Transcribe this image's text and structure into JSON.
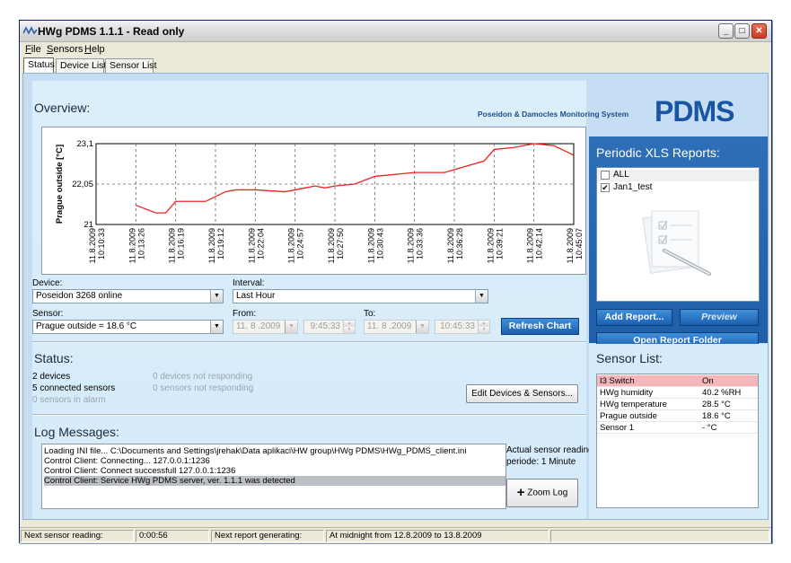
{
  "window": {
    "title": "HWg PDMS 1.1.1 - Read only"
  },
  "menu": {
    "items": [
      "File",
      "Sensors",
      "Help"
    ]
  },
  "tabs": [
    "Status",
    "Device List",
    "Sensor List"
  ],
  "brand": {
    "tagline": "Poseidon & Damocles Monitoring System",
    "logo": "PDMS"
  },
  "overview": {
    "title": "Overview:",
    "chart_data": {
      "type": "line",
      "ylabel": "Prague outside [°C]",
      "ylim": [
        21,
        23.1
      ],
      "yticks": [
        "23,1",
        "22,05",
        "21"
      ],
      "x": [
        "11.8.2009 10:10:33",
        "11.8.2009 10:13:26",
        "11.8.2009 10:16:19",
        "11.8.2009 10:19:12",
        "11.8.2009 10:22:04",
        "11.8.2009 10:24:57",
        "11.8.2009 10:27:50",
        "11.8.2009 10:30:43",
        "11.8.2009 10:33:36",
        "11.8.2009 10:36:28",
        "11.8.2009 10:39:21",
        "11.8.2009 10:42:14",
        "11.8.2009 10:45:07"
      ],
      "series": [
        {
          "color": "#ee2222",
          "points": [
            [
              1.0,
              21.5
            ],
            [
              1.5,
              21.3
            ],
            [
              1.75,
              21.3
            ],
            [
              2.0,
              21.6
            ],
            [
              2.75,
              21.6
            ],
            [
              3.25,
              21.85
            ],
            [
              3.5,
              21.9
            ],
            [
              4.0,
              21.9
            ],
            [
              4.75,
              21.85
            ],
            [
              5.0,
              21.9
            ],
            [
              5.5,
              22.0
            ],
            [
              5.75,
              21.95
            ],
            [
              6.0,
              22.0
            ],
            [
              6.5,
              22.05
            ],
            [
              7.0,
              22.25
            ],
            [
              8.0,
              22.35
            ],
            [
              8.75,
              22.35
            ],
            [
              9.25,
              22.5
            ],
            [
              9.75,
              22.65
            ],
            [
              10.0,
              22.95
            ],
            [
              10.5,
              23.0
            ],
            [
              11.0,
              23.1
            ],
            [
              11.5,
              23.05
            ],
            [
              11.8,
              22.9
            ],
            [
              12.0,
              22.8
            ]
          ]
        }
      ]
    },
    "device": {
      "label": "Device:",
      "value": "Poseidon 3268 online"
    },
    "interval": {
      "label": "Interval:",
      "value": "Last Hour"
    },
    "sensor": {
      "label": "Sensor:",
      "value": "Prague outside = 18.6 °C"
    },
    "from": {
      "label": "From:",
      "date": "11. 8 .2009",
      "time": "9:45:33"
    },
    "to": {
      "label": "To:",
      "date": "11. 8 .2009",
      "time": "10:45:33"
    },
    "refresh_button": "Refresh Chart"
  },
  "status": {
    "title": "Status:",
    "devices": "2 devices",
    "connected": "5 connected sensors",
    "alarm": "0 sensors in alarm",
    "not_responding_devices": "0 devices not responding",
    "not_responding_sensors": "0 sensors not responding",
    "edit_button": "Edit Devices & Sensors..."
  },
  "log": {
    "title": "Log Messages:",
    "lines": [
      "Loading INI file... C:\\Documents and Settings\\jrehak\\Data aplikaci\\HW group\\HWg PDMS\\HWg_PDMS_client.ini",
      "Control Client: Connecting... 127.0.0.1:1236",
      "Control Client: Connect successfull 127.0.0.1:1236",
      "Control Client: Service HWg PDMS server, ver. 1.1.1 was detected"
    ],
    "reading_label": "Actual sensor reading",
    "reading_period": "periode: 1 Minute",
    "zoom_button": "Zoom Log"
  },
  "reports": {
    "title": "Periodic XLS Reports:",
    "items": [
      {
        "label": "ALL",
        "checked": false
      },
      {
        "label": "Jan1_test",
        "checked": true
      }
    ],
    "add_button": "Add Report...",
    "preview_button": "Preview",
    "open_folder_button": "Open Report Folder"
  },
  "sensor_list": {
    "title": "Sensor List:",
    "rows": [
      {
        "name": "I3 Switch",
        "value": "On",
        "alarm": true
      },
      {
        "name": "HWg humidity",
        "value": "40.2 %RH",
        "alarm": false
      },
      {
        "name": "HWg temperature",
        "value": "28.5 °C",
        "alarm": false
      },
      {
        "name": "Prague outside",
        "value": "18.6 °C",
        "alarm": false
      },
      {
        "name": "Sensor 1",
        "value": "- °C",
        "alarm": false
      }
    ]
  },
  "statusbar": {
    "next_reading_label": "Next sensor reading:",
    "next_reading_value": "0:00:56",
    "next_report_label": "Next report generating:",
    "next_report_value": "At midnight from 12.8.2009 to 13.8.2009"
  }
}
